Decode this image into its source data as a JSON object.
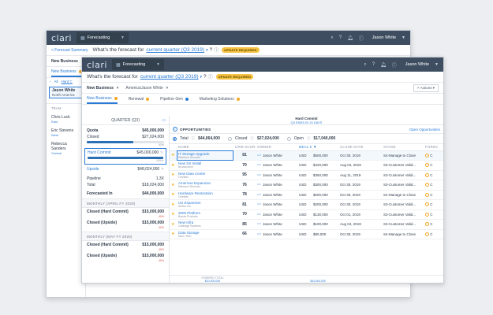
{
  "back_window": {
    "logo": "clari",
    "app": "Forecasting",
    "user": "Jason White",
    "breadcrumb": "< Forecast Summary",
    "question_prefix": "What's the forecast for",
    "question_link": "current quarter (Q3 2019)",
    "question_suffix": "?",
    "badge": "UPDATE REQUIRED",
    "filter_value": "New Business",
    "tab_active": "New Business",
    "all_label": "All",
    "hard_commit_label": "Hard C",
    "selected_person": {
      "name": "Jason White",
      "region": "North America"
    },
    "team_label": "TEAM",
    "team": [
      {
        "name": "Chris Luck",
        "region": "East"
      },
      {
        "name": "Eric Stevens",
        "region": "West"
      },
      {
        "name": "Rebecca Sanders",
        "region": "Central"
      }
    ]
  },
  "front_window": {
    "logo": "clari",
    "app": "Forecasting",
    "user": "Jason White",
    "question_prefix": "What's the forecast for",
    "question_link": "current quarter (Q3 2019)",
    "question_suffix": "?",
    "badge": "UPDATE REQUIRED",
    "filter_value": "New Business",
    "user_filter": "America\\Jason White",
    "actions_label": "Actions",
    "tabs": [
      {
        "label": "New Business",
        "dot": "orange"
      },
      {
        "label": "Renewal",
        "dot": "orange"
      },
      {
        "label": "Pipeline Gen",
        "dot": "blue"
      },
      {
        "label": "Marketing Solutions",
        "dot": "orange"
      }
    ],
    "left_panel": {
      "header": "QUARTER (Q3)",
      "quota": {
        "label": "Quota",
        "value": "$45,000,000"
      },
      "closed": {
        "label": "Closed",
        "value": "$27,024,000",
        "pct": "60%",
        "fill": 0.6
      },
      "hard_commit": {
        "label": "Hard Commit",
        "value": "$45,000,000",
        "pct": "100%",
        "fill": 1.0
      },
      "upside": {
        "label": "Upside",
        "value": "$48,024,000"
      },
      "pipeline": {
        "label": "Pipeline",
        "value": "1.3X"
      },
      "total": {
        "label": "Total",
        "value": "$18,024,000"
      },
      "forecasted_in": {
        "label": "Forecasted In",
        "value": "$44,000,000"
      },
      "months": [
        {
          "title": "MONTHLY (APRIL FY 2020)",
          "rows": [
            {
              "label": "Closed (Hard Commit)",
              "value": "$15,000,000",
              "sub": "40%"
            },
            {
              "label": "Closed (Upside)",
              "value": "$15,000,000",
              "sub": "40%"
            }
          ]
        },
        {
          "title": "MONTHLY (MAY FY 2020)",
          "rows": [
            {
              "label": "Closed (Hard Commit)",
              "value": "$15,000,000",
              "sub": "40%"
            },
            {
              "label": "Closed (Upside)",
              "value": "$15,000,000",
              "sub": "40%"
            }
          ]
        }
      ]
    },
    "hc_header": {
      "title": "Hard Commit",
      "sub": "Q3 ENDS IN 15 DAYS"
    },
    "opportunities": {
      "title": "OPPORTUNITIES",
      "link": "Open Opportunities",
      "totals": [
        {
          "label": "Total",
          "value": "$44,064,000",
          "selected": true
        },
        {
          "label": "Closed",
          "value": "$27,024,000",
          "selected": false
        },
        {
          "label": "Open",
          "value": "$17,040,000",
          "selected": false
        }
      ],
      "columns": [
        "",
        "NAME",
        "CRM SCORE",
        "OWNER",
        "DEAL SIZE",
        "",
        "CLOSE DATE",
        "STAGE",
        "FOREC"
      ],
      "rows": [
        {
          "star": true,
          "name": "IT Storage Upgrade",
          "account": "Rainbow Services",
          "score": "81",
          "owner": "Jason White",
          "currency": "USD",
          "size": "$500,000",
          "date": "Oct 30, 2019",
          "stage": "S4-Manage to Close",
          "fc": "C"
        },
        {
          "star": true,
          "name": "New SS Install",
          "account": "Broadcomm",
          "score": "70",
          "owner": "Jason White",
          "currency": "USD",
          "size": "$420,000",
          "date": "Aug 04, 2019",
          "stage": "S3-Customer Valid...",
          "fc": "C"
        },
        {
          "star": true,
          "name": "New Data Center",
          "account": "Omnitec",
          "score": "95",
          "owner": "Jason White",
          "currency": "USD",
          "size": "$350,000",
          "date": "Aug 11, 2019",
          "stage": "S3-Customer Valid...",
          "fc": "C"
        },
        {
          "star": true,
          "name": "Americas Expansion",
          "account": "Rainbow Services",
          "score": "76",
          "owner": "Jason White",
          "currency": "USD",
          "size": "$300,000",
          "date": "Oct 30, 2019",
          "stage": "S3-Customer Valid...",
          "fc": "C"
        },
        {
          "star": true,
          "name": "Hardware Restoration",
          "account": "Omnitec",
          "score": "78",
          "owner": "Jason White",
          "currency": "USD",
          "size": "$200,000",
          "date": "Oct 30, 2019",
          "stage": "S4-Manage to Close",
          "fc": "C"
        },
        {
          "star": true,
          "name": "US Expansion",
          "account": "Amber Inc.",
          "score": "81",
          "owner": "Jason White",
          "currency": "USD",
          "size": "$200,000",
          "date": "Oct 30, 2019",
          "stage": "S3-Customer Valid...",
          "fc": "C"
        },
        {
          "star": true,
          "name": "3000 Platform",
          "account": "Banda Products",
          "score": "70",
          "owner": "Jason White",
          "currency": "USD",
          "size": "$130,000",
          "date": "Oct 01, 2019",
          "stage": "S3-Customer Valid...",
          "fc": "C"
        },
        {
          "star": true,
          "name": "New Infra",
          "account": "Cabbage Systems",
          "score": "85",
          "owner": "Jason White",
          "currency": "USD",
          "size": "$100,000",
          "date": "Aug 04, 2019",
          "stage": "S3-Customer Valid...",
          "fc": "C"
        },
        {
          "star": true,
          "name": "Data Storage",
          "account": "Nevo Tech",
          "score": "66",
          "owner": "Jason White",
          "currency": "USD",
          "size": "$80,000",
          "date": "Oct 30, 2019",
          "stage": "S4-Manage to Close",
          "fc": "C"
        }
      ],
      "footer": {
        "starred_label": "STARRED TOTAL",
        "starred_value": "$10,000,000",
        "deal_total": "$44,064,000"
      }
    }
  }
}
